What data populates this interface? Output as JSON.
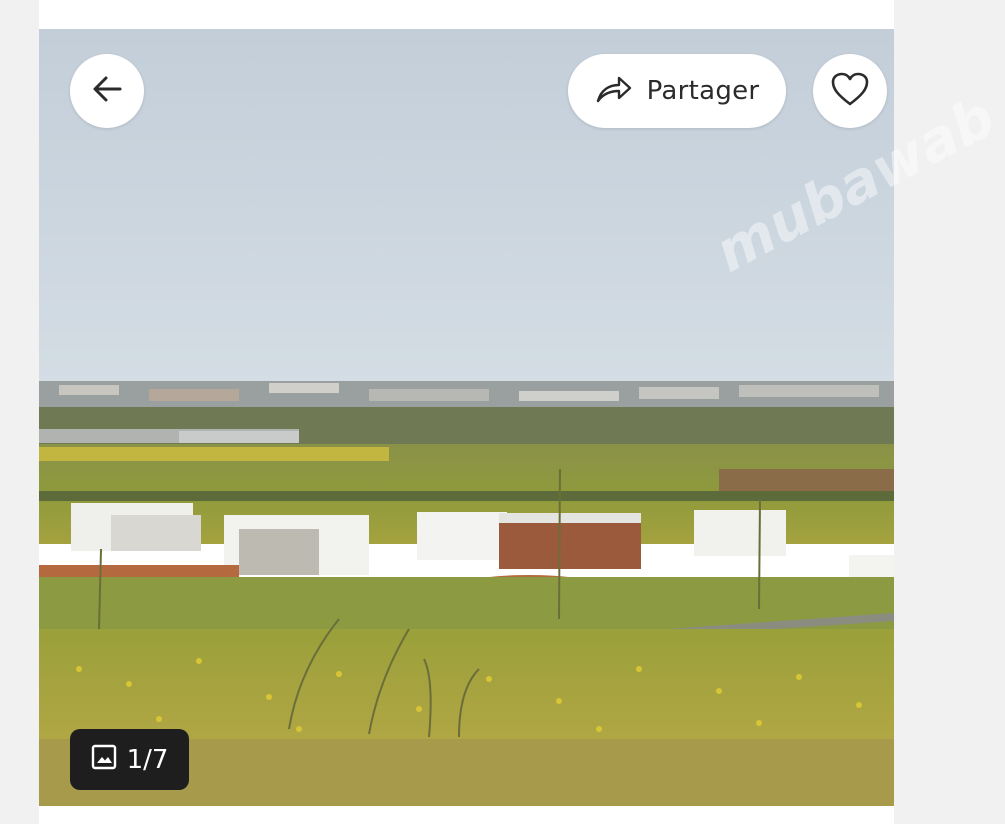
{
  "toolbar": {
    "back_icon": "arrow-left-icon",
    "share_label": "Partager",
    "share_icon": "share-forward-icon",
    "favorite_icon": "heart-outline-icon"
  },
  "gallery": {
    "counter_icon": "image-icon",
    "counter_text": "1/7",
    "watermark_text": "mubawab"
  },
  "colors": {
    "sky": "#c9d4df",
    "field_green": "#7e8f3a",
    "field_yellow": "#b9b34a",
    "button_bg": "#ffffff",
    "counter_bg": "#1e1e1e"
  }
}
